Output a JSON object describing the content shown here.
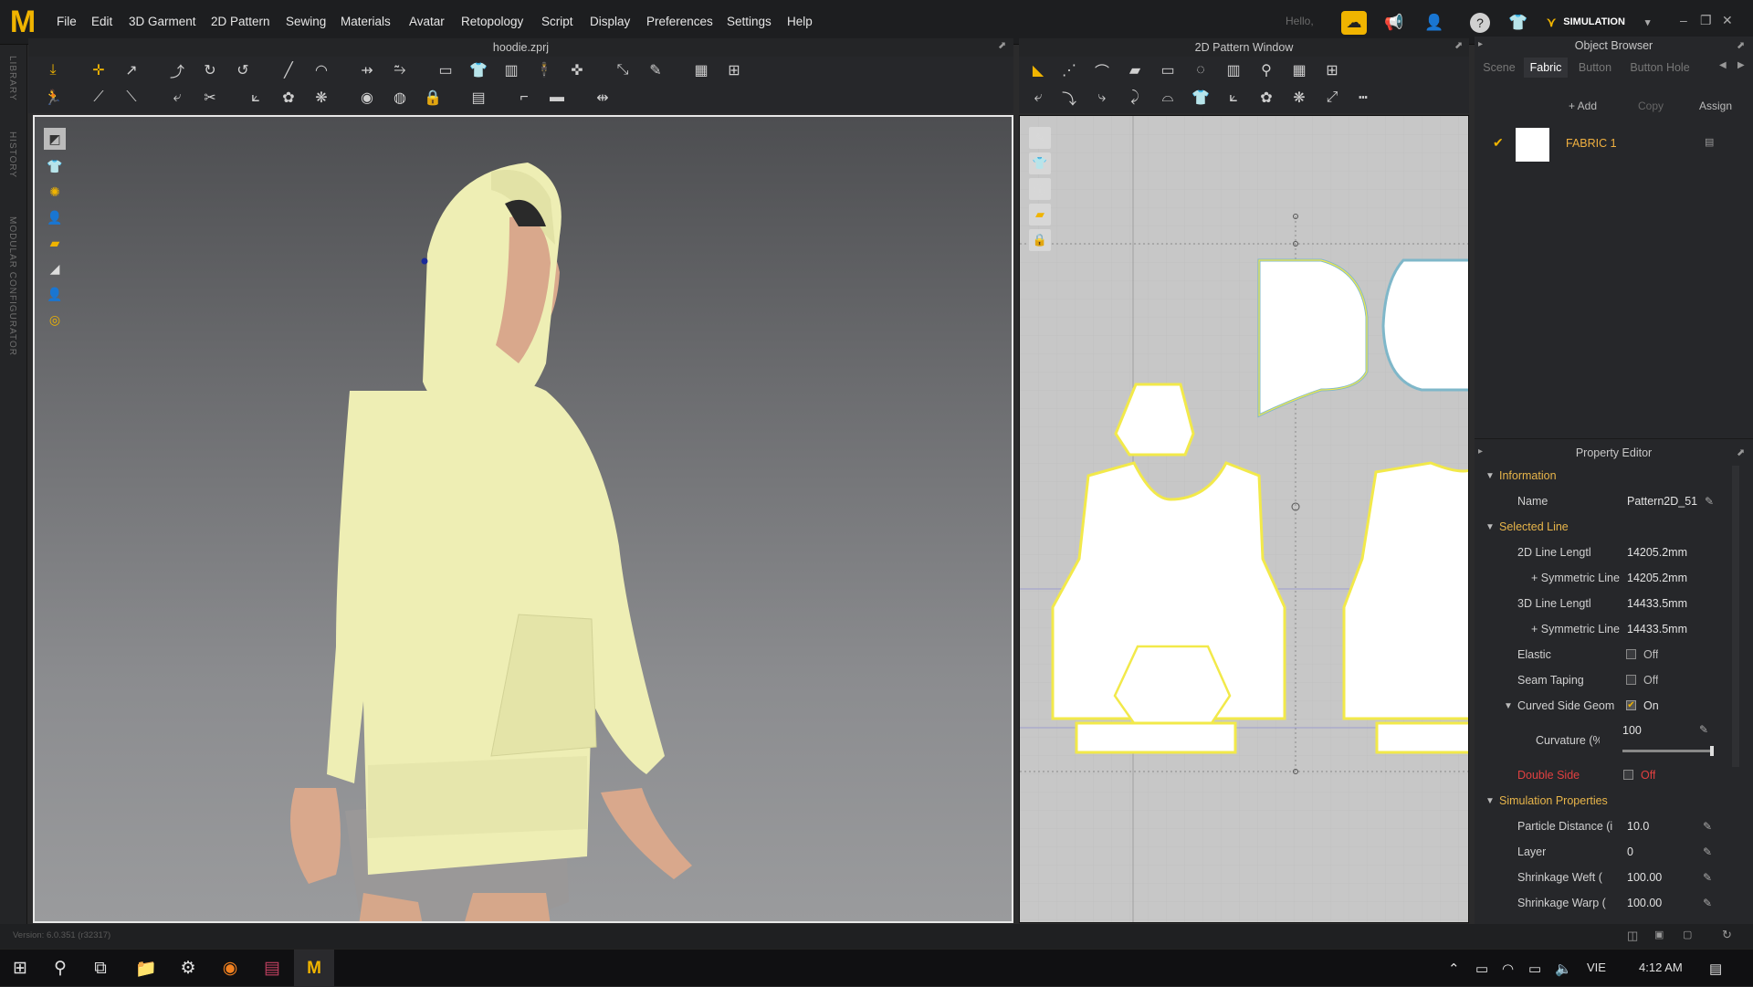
{
  "app": {
    "logo": "M",
    "document": "hoodie.zprj"
  },
  "menu": [
    "File",
    "Edit",
    "3D Garment",
    "2D Pattern",
    "Sewing",
    "Materials",
    "Avatar",
    "Retopology",
    "Script",
    "Display",
    "Preferences",
    "Settings",
    "Help"
  ],
  "topbar": {
    "hello": "Hello,",
    "mode": "SIMULATION"
  },
  "side_tabs": {
    "library": "LIBRARY",
    "history": "HISTORY",
    "modular": "MODULAR CONFIGURATOR"
  },
  "pattern_window": {
    "title": "2D Pattern Window"
  },
  "object_browser": {
    "title": "Object Browser",
    "tabs": [
      "Scene",
      "Fabric",
      "Button",
      "Button Hole"
    ],
    "active_tab": "Fabric",
    "actions": {
      "add": "+ Add",
      "copy": "Copy",
      "assign": "Assign"
    },
    "fabric": {
      "name": "FABRIC 1",
      "swatch_color": "#ffffff"
    }
  },
  "property_editor": {
    "title": "Property Editor",
    "sections": {
      "information": "Information",
      "selected_line": "Selected Line",
      "simulation": "Simulation Properties"
    },
    "name_label": "Name",
    "name_value": "Pattern2D_51",
    "len2d_label": "2D Line Lengtl",
    "len2d_value": "14205.2mm",
    "sym1_label": "+ Symmetric Line",
    "sym1_value": "14205.2mm",
    "len3d_label": "3D Line Lengtl",
    "len3d_value": "14433.5mm",
    "sym2_label": "+ Symmetric Line",
    "sym2_value": "14433.5mm",
    "elastic_label": "Elastic",
    "elastic_value": "Off",
    "seam_label": "Seam Taping",
    "seam_value": "Off",
    "curved_label": "Curved Side Geom",
    "curved_value": "On",
    "curvature_label": "Curvature (%",
    "curvature_value": "100",
    "curvature_level": 1.0,
    "double_label": "Double Side",
    "double_value": "Off",
    "particle_label": "Particle Distance (i",
    "particle_value": "10.0",
    "layer_label": "Layer",
    "layer_value": "0",
    "weft_label": "Shrinkage Weft (",
    "weft_value": "100.00",
    "warp_label": "Shrinkage Warp (",
    "warp_value": "100.00"
  },
  "status": {
    "version": "Version: 6.0.351 (r32317)"
  },
  "taskbar": {
    "lang": "VIE",
    "time": "4:12 AM"
  },
  "colors": {
    "accent": "#e8b54a",
    "garment": "#eeeeb4",
    "pattern_outline": "#f2e94a",
    "selected_red": "#e04040"
  }
}
